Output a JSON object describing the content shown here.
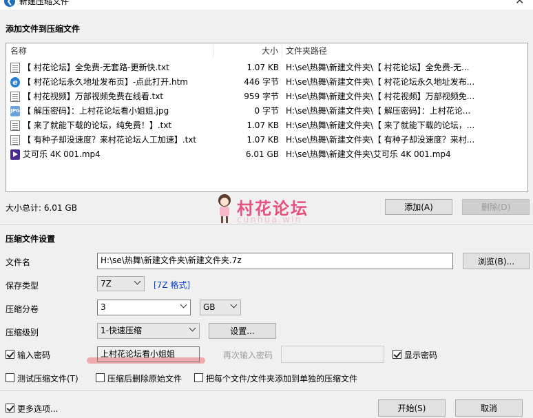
{
  "window": {
    "title": "新建压缩文件",
    "close": "✕"
  },
  "add_section": {
    "title": "添加文件到压缩文件"
  },
  "file_list": {
    "headers": {
      "name": "名称",
      "size": "大小",
      "path": "文件夹路径"
    },
    "rows": [
      {
        "icon": "text-file-icon",
        "name": "【 村花论坛】全免费-无套路-更新快.txt",
        "size": "1.07 KB",
        "path": "H:\\se\\热舞\\新建文件夹\\【 村花论坛】全免费-无..."
      },
      {
        "icon": "html-file-icon",
        "name": "【 村花论坛永久地址发布页】-点此打开.htm",
        "size": "446 字节",
        "path": "H:\\se\\热舞\\新建文件夹\\【 村花论坛永久地址发布..."
      },
      {
        "icon": "text-file-icon",
        "name": "【 村花视频】万部视频免费在线看.txt",
        "size": "959 字节",
        "path": "H:\\se\\热舞\\新建文件夹\\【 村花视频】万部视频免..."
      },
      {
        "icon": "image-file-icon",
        "name": "【 解压密码】：上村花论坛看小姐姐.jpg",
        "size": "0 字节",
        "path": "H:\\se\\热舞\\新建文件夹\\【 解压密码】：上村花论..."
      },
      {
        "icon": "text-file-icon",
        "name": "【 来了就能下载的论坛，纯免费！】.txt",
        "size": "1.07 KB",
        "path": "H:\\se\\热舞\\新建文件夹\\【 来了就能下载的论坛，..."
      },
      {
        "icon": "text-file-icon",
        "name": "【 有种子却没速度？来村花论坛人工加速】.txt",
        "size": "1.07 KB",
        "path": "H:\\se\\热舞\\新建文件夹\\【 有种子却没速度？来村..."
      },
      {
        "icon": "video-file-icon",
        "name": "艾可乐 4K 001.mp4",
        "size": "6.01 GB",
        "path": "H:\\se\\热舞\\新建文件夹\\艾可乐 4K 001.mp4"
      }
    ]
  },
  "total_size": "大小总计: 6.01 GB",
  "buttons": {
    "add": "添加(A)",
    "delete": "删除(D)",
    "browse": "浏览(B)...",
    "settings": "设置...",
    "start": "开始(S)",
    "cancel": "取消"
  },
  "watermark": {
    "text": "村花论坛",
    "sub": "cunhua.win"
  },
  "compress_section": {
    "title": "压缩文件设置"
  },
  "settings": {
    "filename_label": "文件名",
    "filename_value": "H:\\se\\热舞\\新建文件夹\\新建文件夹.7z",
    "type_label": "保存类型",
    "type_value": "7Z",
    "type_link": "[7Z 格式]",
    "split_label": "压缩分卷",
    "split_value": "3",
    "split_unit": "GB",
    "level_label": "压缩级别",
    "level_value": "1-快速压缩",
    "password_label": "输入密码",
    "password_value": "上村花论坛看小姐姐",
    "repeat_label": "再次输入密码",
    "show_password_label": "显示密码"
  },
  "options": {
    "test": "测试压缩文件(T)",
    "delete_after": "压缩后删除原始文件",
    "separate": "把每个文件/文件夹添加到单独的压缩文件",
    "more": "更多选项..."
  },
  "colors": {
    "link": "#0b3ed8",
    "watermark": "#e8517f",
    "highlight": "#f1a2a6"
  }
}
